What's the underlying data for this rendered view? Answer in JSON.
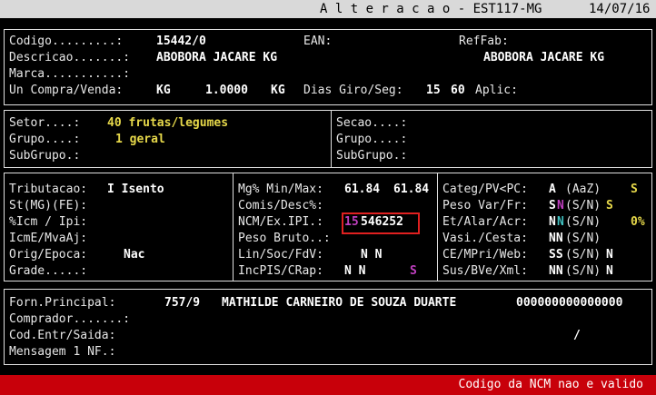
{
  "titlebar": {
    "title": "A l t e r a c a o - EST117-MG",
    "date": "14/07/16"
  },
  "product": {
    "codigo_label": "Codigo.........:",
    "codigo": "15442/0",
    "ean_label": "EAN:",
    "reffab_label": "RefFab:",
    "descricao_label": "Descricao.......:",
    "descricao": "ABOBORA JACARE KG",
    "descricao2": "ABOBORA JACARE KG",
    "marca_label": "Marca...........:",
    "uncompra_label": "Un Compra/Venda:",
    "un_compra": "KG",
    "fator": "1.0000",
    "un_venda": "KG",
    "dias_label": "Dias Giro/Seg:",
    "dias_giro": "15",
    "dias_seg": "60",
    "aplic_label": "Aplic:"
  },
  "classif": {
    "setor_label": "Setor....:",
    "setor": "40 frutas/legumes",
    "grupo_label": "Grupo....:",
    "grupo": "1 geral",
    "subgrupo_label": "SubGrupo.:",
    "secao_label": "Secao....:",
    "grupo2_label": "Grupo....:",
    "subgrupo2_label": "SubGrupo.:"
  },
  "fiscal": {
    "tributacao_label": "Tributacao:",
    "tributacao": "I Isento",
    "st_label": "St(MG)(FE):",
    "icm_label": "%Icm / Ipi:",
    "icme_label": "IcmE/MvaAj:",
    "orig_label": "Orig/Epoca:",
    "orig": "Nac",
    "grade_label": "Grade.....:"
  },
  "margins": {
    "mg_label": "Mg% Min/Max:",
    "mg_min": "61.84",
    "mg_max": "61.84",
    "comis_label": "Comis/Desc%:",
    "ncm_label": "NCM/Ex.IPI.:",
    "ncm_prefix": "15",
    "ncm_rest": "546252",
    "peso_label": "Peso Bruto..:",
    "lin_label": "Lin/Soc/FdV:",
    "lin_value": "N N",
    "inc_label": "IncPIS/CRap:",
    "inc_value": "N N",
    "inc_extra": "S"
  },
  "categ": {
    "categ_label": "Categ/PV<PC:",
    "categ_value": "A",
    "categ_hint": "(AaZ)",
    "categ_extra": "S",
    "pesovar_label": "Peso Var/Fr:",
    "pesovar_s": "S",
    "pesovar_n": "N",
    "pesovar_hint": "(S/N)",
    "pesovar_extra": "S",
    "etalar_label": "Et/Alar/Acr:",
    "etalar_n1": "N",
    "etalar_n2": "N",
    "etalar_hint": "(S/N)",
    "etalar_pct": "0%",
    "vasi_label": "Vasi./Cesta:",
    "vasi_value": "NN",
    "vasi_hint": "(S/N)",
    "ce_label": "CE/MPri/Web:",
    "ce_value": "SS",
    "ce_hint": "(S/N)",
    "ce_extra": "N",
    "sus_label": "Sus/BVe/Xml:",
    "sus_value": "NN",
    "sus_hint": "(S/N)",
    "sus_extra": "N"
  },
  "supplier": {
    "forn_label": "Forn.Principal:",
    "forn_code": "757/9",
    "forn_name": "MATHILDE CARNEIRO DE SOUZA DUARTE",
    "forn_doc": "000000000000000",
    "comprador_label": "Comprador.......:",
    "cod_label": "Cod.Entr/Saida:",
    "cod_value": "/",
    "msg_label": "Mensagem 1 NF.:"
  },
  "status": {
    "message": "Codigo da NCM nao e valido"
  }
}
